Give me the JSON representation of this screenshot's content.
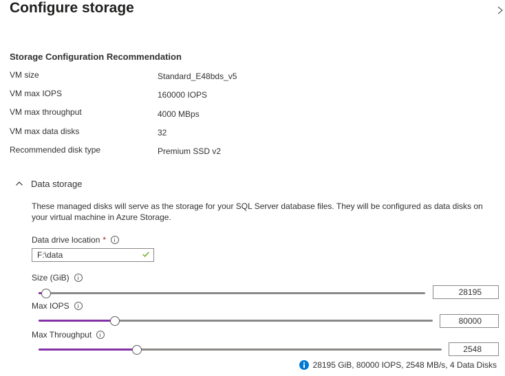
{
  "panel": {
    "title": "Configure storage",
    "close_icon": "close-icon"
  },
  "recommendation": {
    "heading": "Storage Configuration Recommendation",
    "rows": [
      {
        "label": "VM size",
        "value": "Standard_E48bds_v5"
      },
      {
        "label": "VM max IOPS",
        "value": "160000 IOPS"
      },
      {
        "label": "VM max throughput",
        "value": "4000 MBps"
      },
      {
        "label": "VM max data disks",
        "value": "32"
      },
      {
        "label": "Recommended disk type",
        "value": "Premium SSD v2"
      }
    ]
  },
  "data_storage": {
    "label": "Data storage",
    "expanded": true,
    "description": "These managed disks will serve as the storage for your SQL Server database files. They will be configured as data disks on your virtual machine in Azure Storage.",
    "drive_location": {
      "label": "Data drive location",
      "required_marker": "*",
      "value": "F:\\data",
      "valid": true
    },
    "size": {
      "label": "Size (GiB)",
      "value": "28195",
      "slider_fraction": 0.02
    },
    "iops": {
      "label": "Max IOPS",
      "value": "80000",
      "slider_fraction": 0.193
    },
    "throughput": {
      "label": "Max Throughput",
      "value": "2548",
      "slider_fraction": 0.244
    },
    "summary": "28195 GiB, 80000 IOPS, 2548 MB/s, 4 Data Disks"
  },
  "colors": {
    "accent": "#8331a7",
    "info": "#0078d4",
    "required": "#a4262c",
    "valid": "#57a300"
  }
}
